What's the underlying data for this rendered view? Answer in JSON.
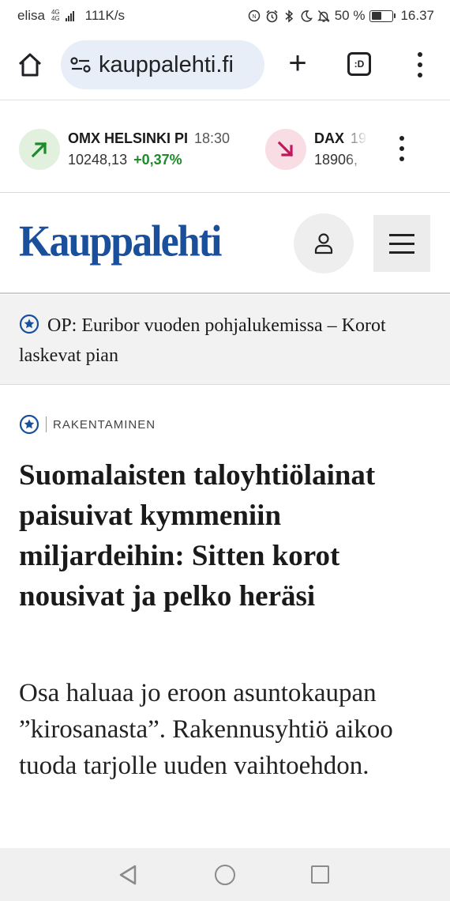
{
  "status_bar": {
    "carrier": "elisa",
    "network_type": "4G",
    "network_sub": "4G",
    "data_rate": "111K/s",
    "battery_percent": "50 %",
    "battery_level": 0.5,
    "time": "16.37",
    "icons": [
      "nfc-icon",
      "alarm-icon",
      "bluetooth-icon",
      "moon-icon",
      "mute-icon"
    ]
  },
  "browser": {
    "url": "kauppalehti.fi",
    "tab_icon_label": ":D"
  },
  "ticker": {
    "items": [
      {
        "name": "OMX HELSINKI PI",
        "time": "18:30",
        "value": "10248,13",
        "change": "+0,37%",
        "direction": "up"
      },
      {
        "name": "DAX",
        "time": "19",
        "value": "18906,",
        "change": "",
        "direction": "down"
      }
    ],
    "colors": {
      "up": "#1f8a2b",
      "up_bg": "#e2f1dd",
      "down": "#c2185b",
      "down_bg": "#f8dde4"
    }
  },
  "header": {
    "logo_text": "Kauppalehti",
    "brand_color": "#1a4f9c"
  },
  "banner": {
    "text": "OP: Euribor vuoden pohjalukemissa – Korot laskevat pian"
  },
  "article": {
    "category": "RAKENTAMINEN",
    "headline": "Suomalaisten taloyhtiölainat paisuivat kymmeniin miljardeihin: Sitten korot nousivat ja pelko heräsi",
    "lead": "Osa haluaa jo eroon asuntokaupan ”kirosanasta”. Rakennusyhtiö aikoo tuoda tarjolle uuden vaihtoehdon."
  }
}
